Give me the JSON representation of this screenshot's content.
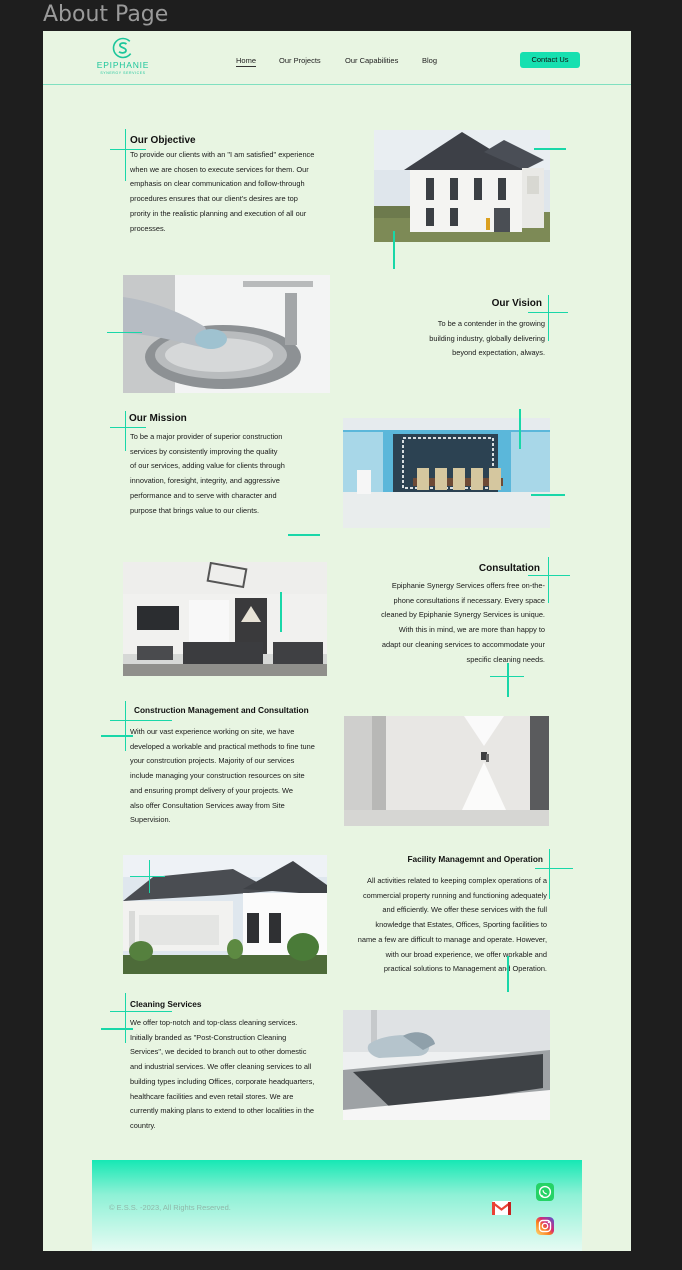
{
  "frame": {
    "title": "About Page"
  },
  "header": {
    "logo_name": "EPIPHANIE",
    "logo_sub": "SYNERGY SERVICES",
    "nav": [
      "Home",
      "Our Projects",
      "Our Capabilities",
      "Blog"
    ],
    "active_nav": "Home",
    "cta": "Contact Us"
  },
  "sections": [
    {
      "title": "Our Objective",
      "text": [
        "To provide our clients with an \"I am satisfied\" experience",
        "when we are chosen to execute services for them. Our",
        "emphasis on clear communication and follow-through",
        "procedures ensures that our client’s  desires are top",
        "prority in the realistic planning and execution of all our",
        "processes."
      ],
      "image": "two-storey-white-house-photo"
    },
    {
      "title": "Our Vision",
      "text": [
        "To be a contender in the growing",
        "building industry, globally delivering",
        "beyond expectation, always."
      ],
      "image": "gloved-hand-cleaning-sink-photo"
    },
    {
      "title": "Our Mission",
      "text": [
        "To be a major provider of superior construction",
        "services by consistently improving the quality",
        "of our services, adding value for clients through",
        "innovation, foresight, integrity, and aggressive",
        "performance and to serve with character and",
        "purpose that brings value to our clients."
      ],
      "image": "dining-room-interior-photo"
    },
    {
      "title": "Consultation",
      "text": [
        "Epiphanie Synergy Services offers free on-the-",
        "phone consultations if necessary. Every space",
        "cleaned by Epiphanie Synergy Services is unique.",
        "With this in mind, we are more than happy to",
        "adapt our cleaning services to accommodate your",
        "specific cleaning needs."
      ],
      "image": "living-room-interior-photo"
    },
    {
      "title": "Construction Management and Consultation",
      "text": [
        "With our vast experience working on site, we have",
        "developed a workable and practical methods to fine tune",
        "your constrcution projects. Majority of our services",
        "include managing your construction resources on site",
        "and ensuring prompt delivery of your projects. We",
        "also offer Consultation Services away from Site",
        "Supervision."
      ],
      "image": "white-corridor-wall-light-photo"
    },
    {
      "title": "Facility Managemnt and Operation",
      "text": [
        "All activities related to keeping complex operations of a",
        "commercial property running and functioning adequately",
        "and efficiently. We offer these services with the full",
        "knowledge that Estates, Offices, Sporting facilities to",
        "name a few are difficult to manage and operate. However,",
        "with our broad experience, we offer workable and",
        "practical solutions to Management and Operation."
      ],
      "image": "bungalow-patio-exterior-photo"
    },
    {
      "title": "Cleaning Services",
      "text": [
        "We offer top-notch and top-class cleaning services.",
        "Initially branded as \"Post-Construction Cleaning",
        "Services\", we decided to branch out to other domestic",
        "and industrial services. We offer cleaning services to all",
        "building types including Offices, corporate headquarters,",
        "healthcare facilities and even retail stores. We are",
        "currently making plans to extend to other localities in the",
        "country."
      ],
      "image": "gloved-hand-wiping-counter-photo"
    }
  ],
  "footer": {
    "copyright": "© E.S.S. -2023, All Rights Reserved.",
    "icons": [
      "gmail-icon",
      "whatsapp-icon",
      "instagram-icon"
    ]
  },
  "colors": {
    "accent": "#19d7a8",
    "page_bg": "#e8f5e2",
    "canvas_bg": "#1e1e1e"
  }
}
